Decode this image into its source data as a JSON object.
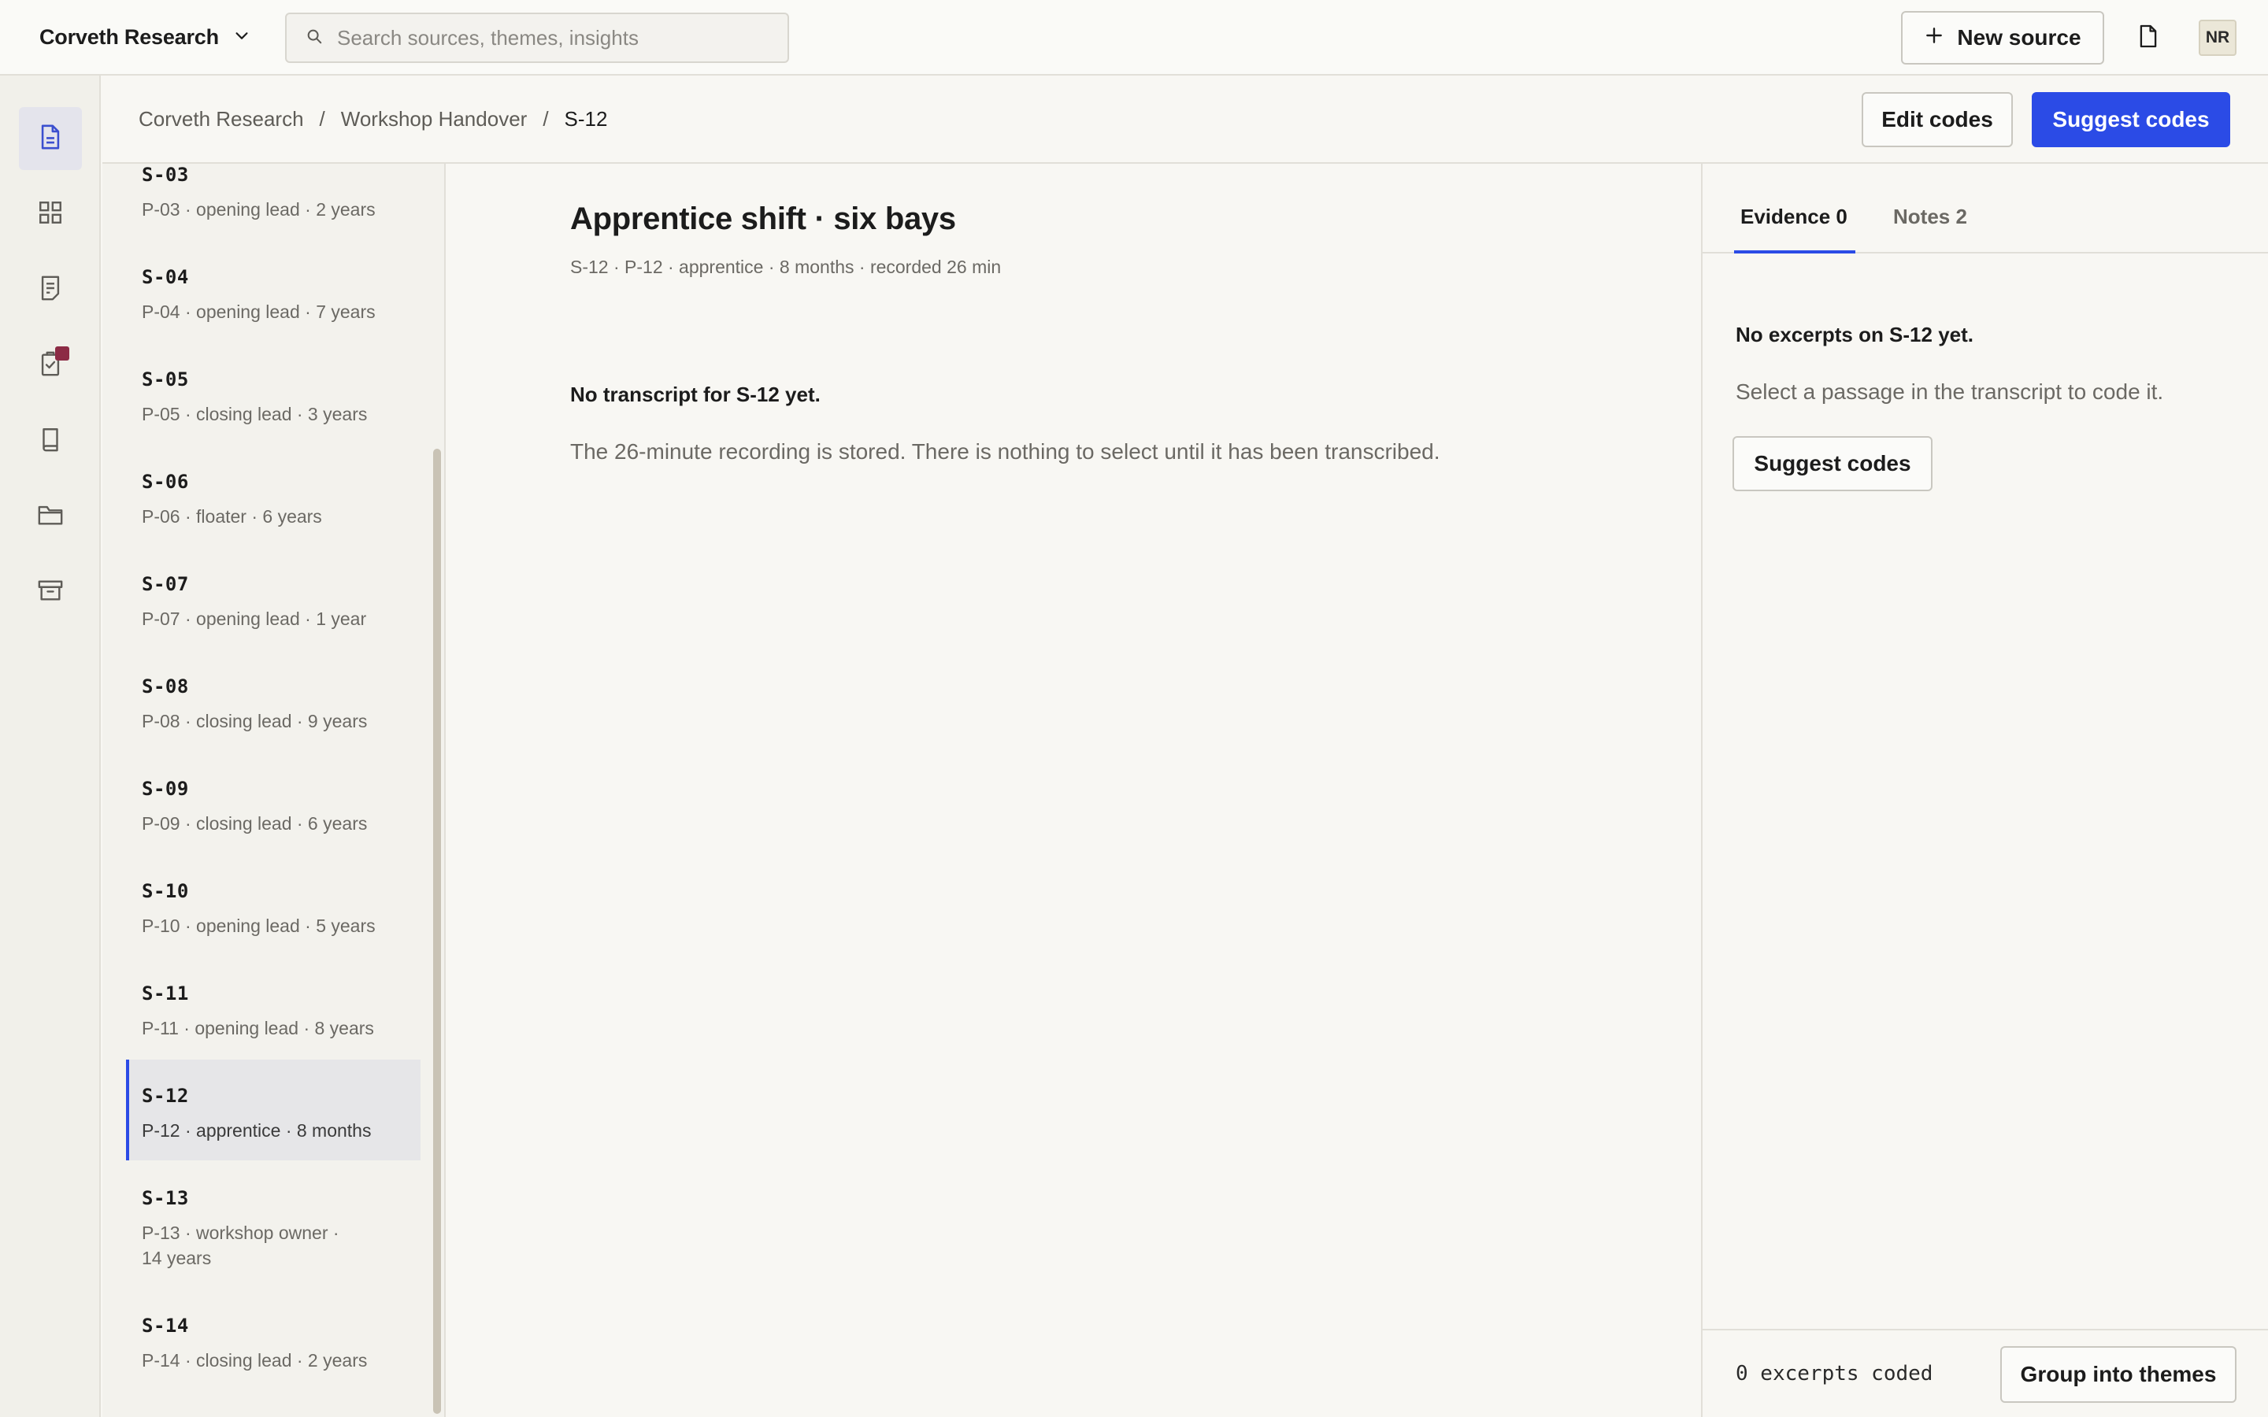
{
  "topbar": {
    "workspace": "Corveth Research",
    "workspace_icon": "chevron-down-icon",
    "search_placeholder": "Search sources, themes, insights",
    "new_source_label": "New source",
    "avatar_initials": "NR"
  },
  "rail": {
    "items": [
      {
        "icon": "document-icon",
        "active": true
      },
      {
        "icon": "grid-icon",
        "active": false
      },
      {
        "icon": "note-icon",
        "active": false
      },
      {
        "icon": "clipboard-check-icon",
        "active": false,
        "badge": true
      },
      {
        "icon": "book-icon",
        "active": false
      },
      {
        "icon": "folder-icon",
        "active": false
      },
      {
        "icon": "archive-icon",
        "active": false
      }
    ],
    "badge_color": "#8c2b45"
  },
  "breadcrumb": {
    "items": [
      "Corveth Research",
      "Workshop Handover"
    ],
    "separator": "/",
    "current": "S-12"
  },
  "actions": {
    "edit_codes": "Edit codes",
    "suggest_codes": "Suggest codes"
  },
  "sources": [
    {
      "id": "S-03",
      "meta": "P-03 · opening lead · 2 years"
    },
    {
      "id": "S-04",
      "meta": "P-04 · opening lead · 7 years"
    },
    {
      "id": "S-05",
      "meta": "P-05 · closing lead · 3 years"
    },
    {
      "id": "S-06",
      "meta": "P-06 · floater · 6 years"
    },
    {
      "id": "S-07",
      "meta": "P-07 · opening lead · 1 year"
    },
    {
      "id": "S-08",
      "meta": "P-08 · closing lead · 9 years"
    },
    {
      "id": "S-09",
      "meta": "P-09 · closing lead · 6 years"
    },
    {
      "id": "S-10",
      "meta": "P-10 · opening lead · 5 years"
    },
    {
      "id": "S-11",
      "meta": "P-11 · opening lead · 8 years"
    },
    {
      "id": "S-12",
      "meta": "P-12 · apprentice · 8 months",
      "selected": true
    },
    {
      "id": "S-13",
      "meta_line1": "P-13 · workshop owner ·",
      "meta_line2": "14 years"
    },
    {
      "id": "S-14",
      "meta": "P-14 · closing lead · 2 years"
    }
  ],
  "document": {
    "title": "Apprentice shift · six bays",
    "meta": "S-12 · P-12 · apprentice · 8 months · recorded 26 min",
    "empty_heading": "No transcript for S-12 yet.",
    "empty_body": "The 26-minute recording is stored. There is nothing to select until it has been transcribed."
  },
  "panel": {
    "tabs": [
      {
        "label": "Evidence 0",
        "active": true
      },
      {
        "label": "Notes 2",
        "active": false
      }
    ],
    "heading": "No excerpts on S-12 yet.",
    "body": "Select a passage in the transcript to code it.",
    "suggest_label": "Suggest codes",
    "footer_count": "0 excerpts coded",
    "group_label": "Group into themes"
  },
  "colors": {
    "accent": "#2b4be6",
    "background": "#f8f7f3",
    "muted_text": "#6b6964"
  }
}
